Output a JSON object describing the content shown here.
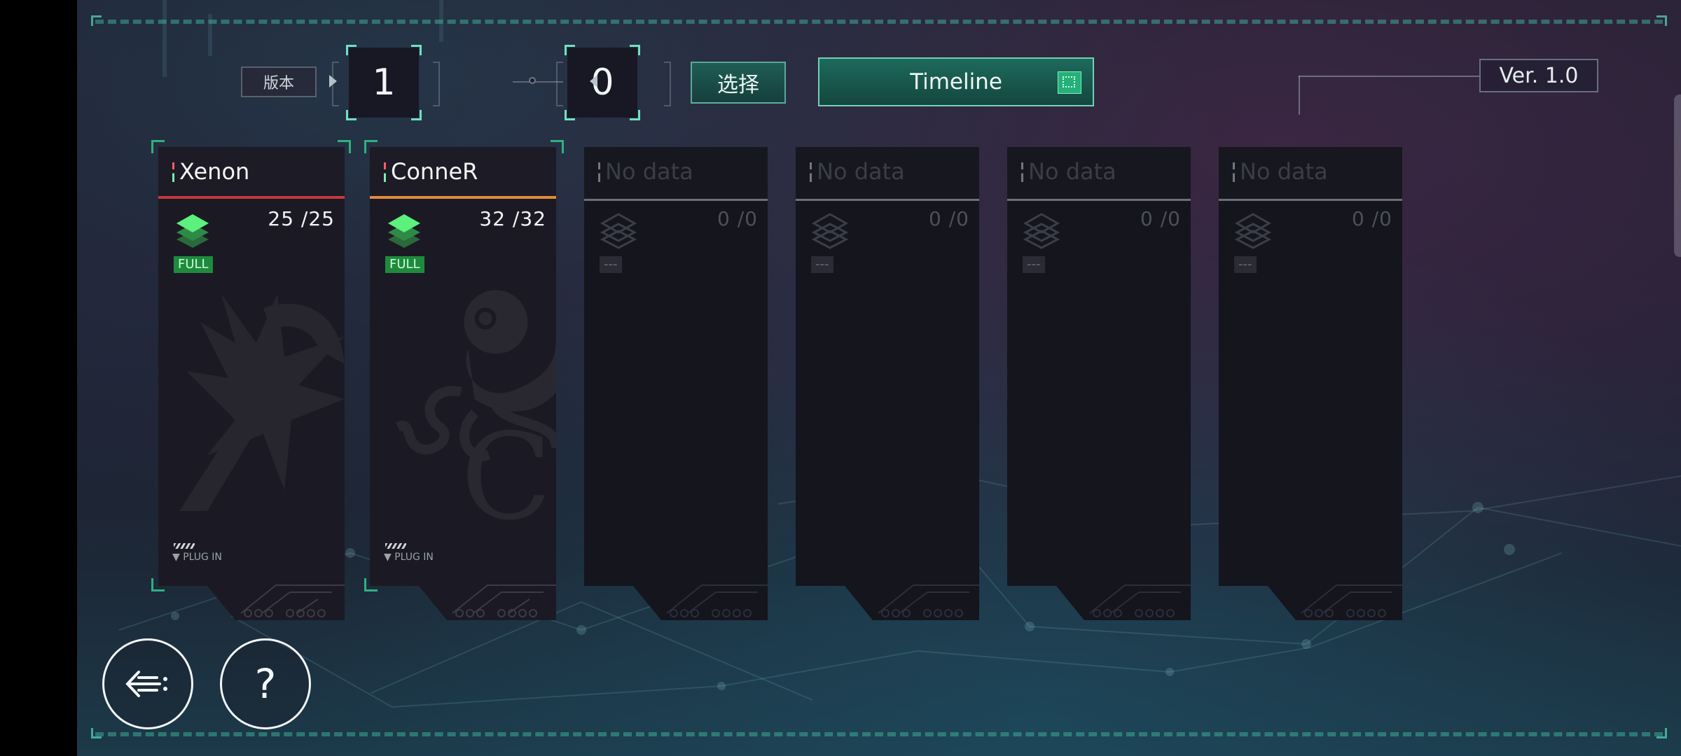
{
  "header": {
    "version_label": "版本",
    "major_digit": "1",
    "minor_digit": "0",
    "select_label": "选择",
    "timeline_label": "Timeline",
    "version_text": "Ver. 1.0"
  },
  "cards": [
    {
      "title": "Xenon",
      "count": "25 /25",
      "status": "FULL",
      "plugin": "▼ PLUG IN",
      "accent": "#c23a3a"
    },
    {
      "title": "ConneR",
      "count": "32 /32",
      "status": "FULL",
      "plugin": "▼ PLUG IN",
      "accent": "#e08a3a"
    },
    {
      "title": "No data",
      "count": "0 /0",
      "status": "---"
    },
    {
      "title": "No data",
      "count": "0 /0",
      "status": "---"
    },
    {
      "title": "No data",
      "count": "0 /0",
      "status": "---"
    },
    {
      "title": "No data",
      "count": "0 /0",
      "status": "---"
    }
  ],
  "footer": {
    "back_icon": "back-arrow-icon",
    "help_label": "?"
  },
  "colors": {
    "accent_green": "#2fb07f",
    "full_badge": "#1f8a3e"
  }
}
